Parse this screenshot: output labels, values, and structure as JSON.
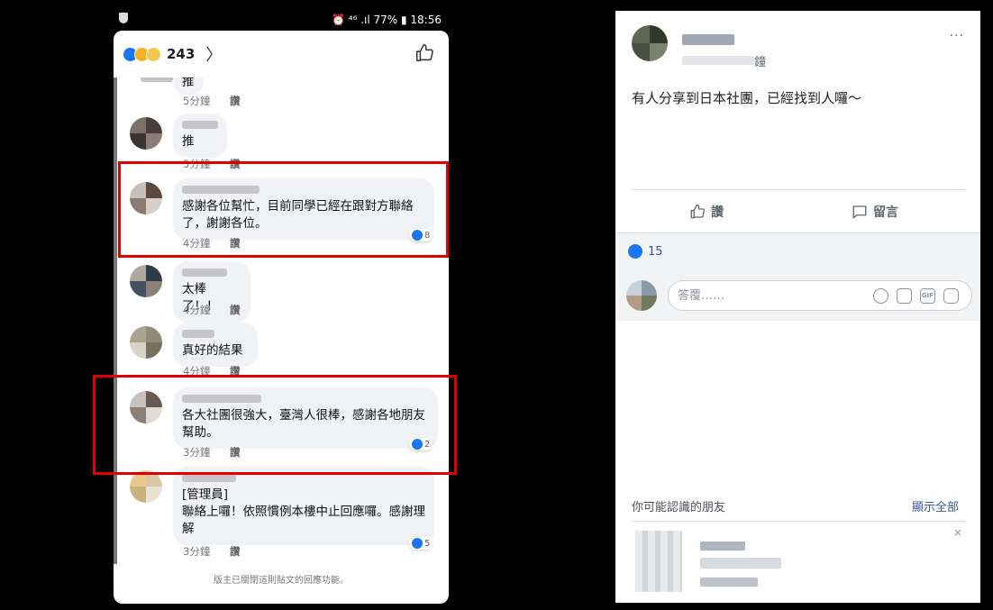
{
  "phone": {
    "status_bar": {
      "right": "⏰ ⁴⁶ .ıl 77% ▮ 18:56"
    },
    "header": {
      "reaction_count": "243",
      "chevron": "〉"
    },
    "comments": [
      {
        "text": "推",
        "time": "5分鐘",
        "like": "讚"
      },
      {
        "text": "推",
        "time": "5分鐘",
        "like": "讚"
      },
      {
        "text": "感謝各位幫忙，目前同學已經在跟對方聯絡了，謝謝各位。",
        "time": "4分鐘",
        "like": "讚",
        "reactions": "8"
      },
      {
        "text": "太棒了！！",
        "time": "4分鐘",
        "like": "讚"
      },
      {
        "text": "真好的結果",
        "time": "4分鐘",
        "like": "讚"
      },
      {
        "text": "各大社團很強大，臺灣人很棒，感謝各地朋友幫助。",
        "time": "3分鐘",
        "like": "讚",
        "reactions": "2"
      },
      {
        "role": "[管理員]",
        "text": "聯絡上囉！依照慣例本樓中止回應囉。感謝理解",
        "time": "3分鐘",
        "like": "讚",
        "reactions": "5"
      }
    ],
    "closed_notice": "版主已關閉這則貼文的回應功能。"
  },
  "post": {
    "time_suffix": "鐘",
    "more": "···",
    "text": "有人分享到日本社團，已經找到人囉～",
    "actions": {
      "like": "讚",
      "comment": "留言"
    },
    "like_count": "15",
    "composer_placeholder": "答覆……",
    "gif_label": "GIF",
    "pymk": {
      "title": "你可能認識的朋友",
      "see_all": "顯示全部",
      "close": "×"
    }
  },
  "colors": {
    "accent": "#1877f2",
    "highlight": "#e00000",
    "link": "#385898"
  }
}
